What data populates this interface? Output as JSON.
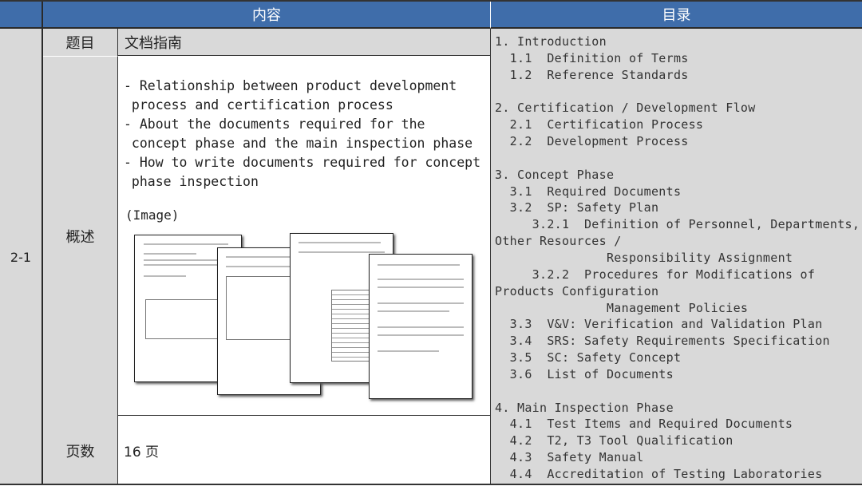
{
  "header": {
    "content": "内容",
    "toc": "目录"
  },
  "row_id": "2-1",
  "title_row": {
    "label": "题目",
    "value": "文档指南"
  },
  "summary_row": {
    "label": "概述",
    "lines": [
      "- Relationship between product development",
      " process and certification process",
      "- About the documents required for the",
      " concept phase and the main inspection phase",
      "- How to write documents required for concept",
      " phase inspection"
    ],
    "image_label": "(Image)"
  },
  "pages_row": {
    "label": "页数",
    "value": "16 页"
  },
  "toc": [
    "1. Introduction",
    "  1.1  Definition of Terms",
    "  1.2  Reference Standards",
    "",
    "2. Certification / Development Flow",
    "  2.1  Certification Process",
    "  2.2  Development Process",
    "",
    "3. Concept Phase",
    "  3.1  Required Documents",
    "  3.2  SP: Safety Plan",
    "     3.2.1  Definition of Personnel, Departments,",
    "Other Resources /",
    "               Responsibility Assignment",
    "     3.2.2  Procedures for Modifications of",
    "Products Configuration",
    "               Management Policies",
    "  3.3  V&V: Verification and Validation Plan",
    "  3.4  SRS: Safety Requirements Specification",
    "  3.5  SC: Safety Concept",
    "  3.6  List of Documents",
    "",
    "4. Main Inspection Phase",
    "  4.1  Test Items and Required Documents",
    "  4.2  T2, T3 Tool Qualification",
    "  4.3  Safety Manual",
    "  4.4  Accreditation of Testing Laboratories"
  ],
  "colors": {
    "header": "#3f6daa",
    "cell_gray": "#d9d9d9"
  }
}
